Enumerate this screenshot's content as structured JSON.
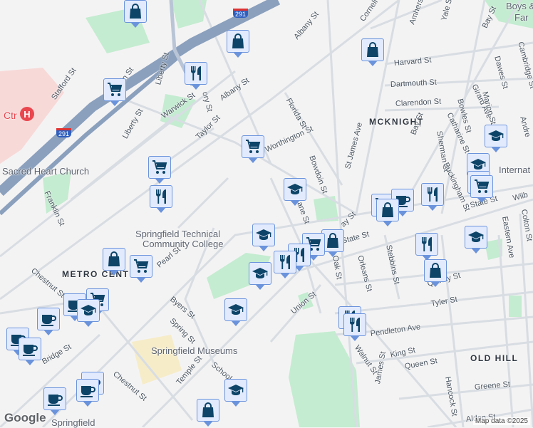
{
  "map": {
    "attribution": "Map data ©2025",
    "logo": "Google",
    "highway_shield": "291",
    "hospital_label": "Ctr",
    "neighborhoods": {
      "mcknight": "MCKNIGHT",
      "metro": "METRO CENT",
      "oldhill": "OLD HILL",
      "boys": "Boys &",
      "boys2": "Far"
    },
    "pois": {
      "church": "Sacred Heart Church",
      "stcc1": "Springfield Technical",
      "stcc2": "Community College",
      "museums": "Springfield Museums",
      "internat": "Internat",
      "springfield": "Springfield"
    },
    "streets": {
      "stafford": "Stafford St",
      "franklin1": "Franklin St",
      "liberty1": "Liberty St",
      "liberty2": "Liberty St",
      "warwick": "Warwick St",
      "taylor": "Taylor St",
      "albany1": "Albany St",
      "albany2": "Albany St",
      "ory": "ory St",
      "franklin2": "Franklin St",
      "worthington": "Worthington St",
      "florida": "Florida St",
      "bowdoin": "Bowdoin St",
      "stjames": "St James Ave",
      "cornell": "Cornell St",
      "amherst": "Amherst St",
      "yale": "Yale St",
      "harvard": "Harvard St",
      "dartmouth": "Dartmouth St",
      "clarendon": "Clarendon St",
      "bay": "Bay St",
      "bay2": "Bay St",
      "dawes": "Dawes St",
      "cambridge": "Cambridge St",
      "girard": "Girard Ave",
      "marion": "Marion St",
      "bowles": "Bowles St",
      "catharine": "Catharine St",
      "sherman": "Sherman St",
      "buckingham": "Buckingham St",
      "state": "State St",
      "state2": "State St",
      "wilb": "Wilb",
      "eastern": "Eastern Ave",
      "colton": "Colton St",
      "orleans": "Orleans St",
      "stebbins": "Stebbins St",
      "oak": "Oak St",
      "quincy": "Quincy St",
      "tyler": "Tyler St",
      "union": "Union St",
      "pendleton": "Pendleton Ave",
      "walnut": "Walnut St",
      "king": "King St",
      "queen": "Queen St",
      "greene": "Greene St",
      "hancock": "Hancock St",
      "james": "James St",
      "alden": "Alden St",
      "pearl": "Pearl St",
      "byers": "Byers St",
      "spring": "Spring St",
      "chestnut1": "Chestnut St",
      "chestnut2": "Chestnut St",
      "bridge": "Bridge St",
      "school": "School St",
      "temple": "Temple St",
      "ane": "ane St",
      "ay": "ay St",
      "andre": "Andre"
    },
    "pins": [
      "bag",
      "bag",
      "bag",
      "restaurant",
      "cart",
      "cart",
      "cart",
      "restaurant",
      "school",
      "school",
      "bag",
      "cart",
      "restaurant",
      "restaurant",
      "school",
      "school",
      "bag",
      "cart",
      "cart",
      "cup",
      "school",
      "cup",
      "cup",
      "cup",
      "cup",
      "cup",
      "cup",
      "school",
      "bag",
      "restaurant",
      "restaurant",
      "cart",
      "cup",
      "bag",
      "restaurant",
      "restaurant",
      "bag",
      "school",
      "school",
      "school",
      "cart",
      "cart"
    ],
    "colors": {
      "pin_fill": "#e2ebfd",
      "pin_border": "#6a93dc",
      "icon": "#0d4468",
      "park": "#c4ecd0",
      "highway": "#8aa0bd",
      "road": "#d8dde3"
    }
  }
}
